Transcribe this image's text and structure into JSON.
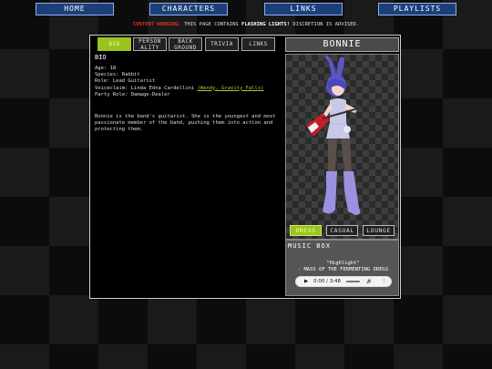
{
  "nav": {
    "home": "HOME",
    "characters": "CHARACTERS",
    "links": "LINKS",
    "playlists": "PLAYLISTS"
  },
  "warning": {
    "label": "CONTENT WARNING:",
    "text1": " THIS PAGE CONTAINS ",
    "emph": "FLASHING LIGHTS!",
    "text2": " DISCRETION IS ADVISED."
  },
  "tabs": [
    {
      "label": "BIO",
      "active": true
    },
    {
      "label": "PERSON ALITY",
      "active": false
    },
    {
      "label": "BACK GROUND",
      "active": false
    },
    {
      "label": "TRIVIA",
      "active": false
    },
    {
      "label": "LINKS",
      "active": false
    }
  ],
  "bio": {
    "title": "BIO",
    "age": "Age: 18",
    "species": "Species: Rabbit",
    "role": "Role: Lead Guitarist",
    "voice": "Voiceclaim: Linda Edna Cardellini ",
    "voice_link": "(Wendy, Gravity Falls)",
    "party": "Party Role: Damage-Dealer",
    "description": "Bonnie is the band's guitarist. She is the youngest and most passionate member of the band, pushing them into action and protecting them."
  },
  "character": {
    "name": "BONNIE",
    "outfits": [
      "DRESS",
      "CASUAL",
      "LOUNGE"
    ],
    "active_outfit": "DRESS"
  },
  "music": {
    "title": "MUSIC BOX",
    "song": "\"Highlight\"",
    "artist": "- MASS OF THE FERMENTING DREGS",
    "time": "0:00 / 3:48"
  },
  "colors": {
    "nav_bg": "#1c3f7a",
    "accent": "#9bc21f",
    "warning": "#e0301e",
    "hair": "#5a55c8"
  }
}
